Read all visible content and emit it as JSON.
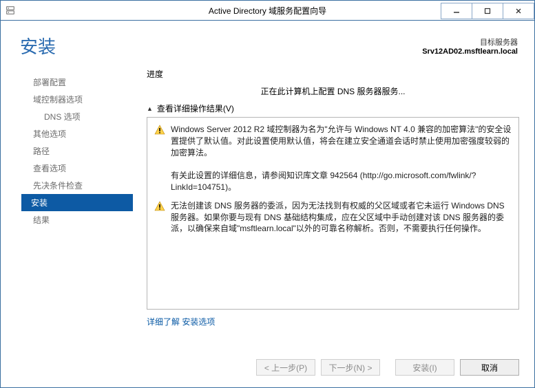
{
  "window": {
    "title": "Active Directory 域服务配置向导"
  },
  "header": {
    "title": "安装",
    "target_label": "目标服务器",
    "target_value": "Srv12AD02.msftlearn.local"
  },
  "sidebar": {
    "items": [
      {
        "label": "部署配置",
        "sub": false,
        "active": false
      },
      {
        "label": "域控制器选项",
        "sub": false,
        "active": false
      },
      {
        "label": "DNS 选项",
        "sub": true,
        "active": false
      },
      {
        "label": "其他选项",
        "sub": false,
        "active": false
      },
      {
        "label": "路径",
        "sub": false,
        "active": false
      },
      {
        "label": "查看选项",
        "sub": false,
        "active": false
      },
      {
        "label": "先决条件检查",
        "sub": false,
        "active": false
      },
      {
        "label": "安装",
        "sub": false,
        "active": true
      },
      {
        "label": "结果",
        "sub": false,
        "active": false
      }
    ]
  },
  "main": {
    "progress_label": "进度",
    "progress_message": "正在此计算机上配置 DNS 服务器服务...",
    "expander_label": "查看详细操作结果(V)",
    "warnings": [
      {
        "text": "Windows Server 2012 R2 域控制器为名为\"允许与 Windows NT 4.0 兼容的加密算法\"的安全设置提供了默认值。对此设置使用默认值，将会在建立安全通道会话时禁止使用加密强度较弱的加密算法。\n\n有关此设置的详细信息，请参阅知识库文章 942564 (http://go.microsoft.com/fwlink/?LinkId=104751)。"
      },
      {
        "text": "无法创建该 DNS 服务器的委派，因为无法找到有权威的父区域或者它未运行 Windows DNS 服务器。如果你要与现有 DNS 基础结构集成，应在父区域中手动创建对该 DNS 服务器的委派，以确保来自域\"msftlearn.local\"以外的可靠名称解析。否则，不需要执行任何操作。"
      }
    ],
    "footer_link": "详细了解 安装选项"
  },
  "buttons": {
    "prev": "< 上一步(P)",
    "next": "下一步(N) >",
    "install": "安装(I)",
    "cancel": "取消"
  },
  "icons": {
    "warning": "warning-icon"
  },
  "chart_data": null
}
